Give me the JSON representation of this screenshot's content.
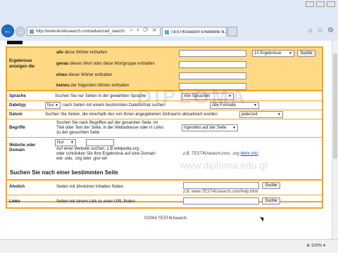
{
  "browser": {
    "url": "http://www.test4usearch.com/advanced_search",
    "tab_title": "TEST4Usearch Erweiterte S...",
    "tab_close": "×",
    "zoom_label": "100%"
  },
  "search": {
    "section_label": "Ergebnisse anzeigen die",
    "rows": [
      {
        "prefix": "alle",
        "suffix": "diese Wörter enthalten"
      },
      {
        "prefix": "genau",
        "suffix": "dieses Wort oder diese Wortgruppe enthalten"
      },
      {
        "prefix": "eines",
        "suffix": "dieser Wörter enthalten"
      },
      {
        "prefix": "keines",
        "suffix": "der folgenden Wörter enthalten"
      }
    ],
    "results_select": "10 Ergebnisse",
    "search_button": "Suche"
  },
  "options": {
    "language": {
      "label": "Sprache",
      "text": "Suchen Sie nur Seiten in der gewählten Sprache",
      "select": "Alle Sprachen"
    },
    "filetype": {
      "label": "Dateityp",
      "select_left": "Nur",
      "text": "nach Seiten mit einem bestimmten Dateiformat suchen",
      "select": "Alle Formate"
    },
    "date": {
      "label": "Datum",
      "text": "Suchen Sie Seiten, die innerhalb des von Ihnen angegebenen Zeitraums aktualisiert wurden",
      "select": "jederzeit"
    },
    "terms": {
      "label": "Begriffe",
      "text_lines": [
        "Suchen Sie nach Begriffen auf der gesamten Seite, im",
        "Titel oder Text der Seite, in der Webadresse oder in Links",
        "zu der gesuchten Seite"
      ],
      "select": "Irgendwo auf der Seite"
    },
    "domain": {
      "label_lines": [
        "Website oder",
        "Domain"
      ],
      "select_left": "Nur",
      "text_lines": [
        "Auf einer Website suchen, z.B wikipedia.org ,",
        "oder schränken Sie Ihre Ergebnisse auf eine Domain",
        "wie .edu, .org oder .gov ein"
      ],
      "note": "z.B. TEST4Usearch.com, .org",
      "more_info": "Mehr Info"
    }
  },
  "similar": {
    "title": "Suchen Sie nach einer bestimmten Seite",
    "rows": [
      {
        "label": "Ähnlich",
        "text": "Seiten mit ähnlichen Inhalten finden",
        "button": "Suche",
        "note": "z.B. www.TEST4Usearch.com/help.html"
      },
      {
        "label": "Links",
        "text": "Seiten mit einem Link zu einer URL finden",
        "button": "Suche"
      }
    ]
  },
  "footer": {
    "copyright": "©2004 TEST4Usearch"
  },
  "watermark": {
    "brand": "DIPLOMA",
    "url": "www.diploma.edu.gr"
  },
  "colors": {
    "accent_border": "#f3a521",
    "panel_fill": "#ffd986",
    "link": "#1a4fc7"
  }
}
